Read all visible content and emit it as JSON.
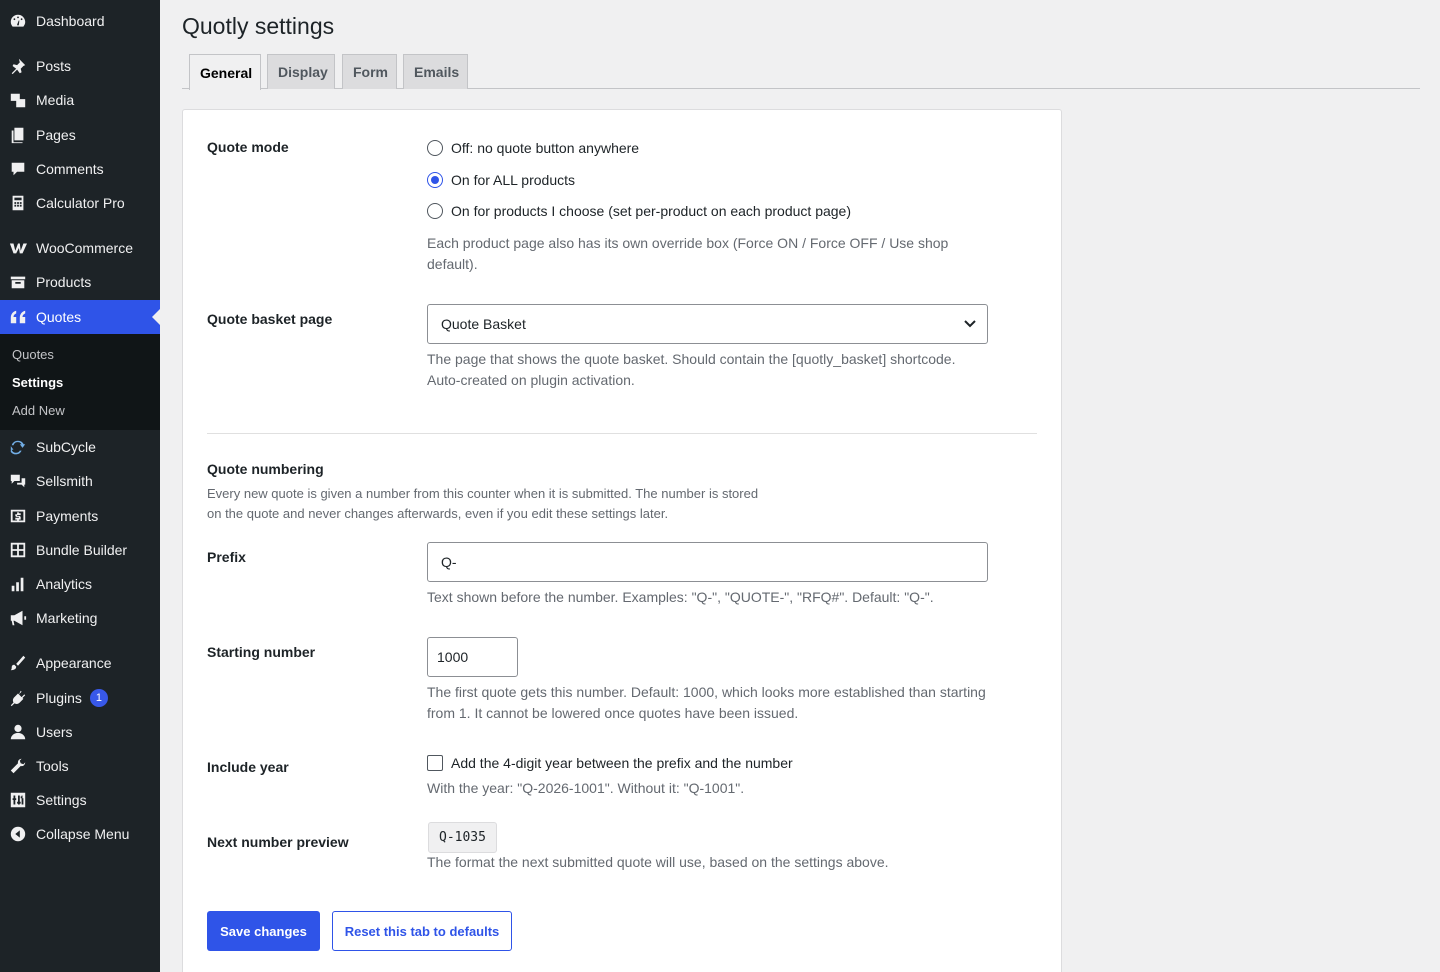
{
  "sidebar": {
    "items": [
      {
        "label": "Dashboard",
        "icon": "dashboard-icon"
      },
      {
        "label": "Posts",
        "icon": "pin-icon"
      },
      {
        "label": "Media",
        "icon": "media-icon"
      },
      {
        "label": "Pages",
        "icon": "pages-icon"
      },
      {
        "label": "Comments",
        "icon": "comment-icon"
      },
      {
        "label": "Calculator Pro",
        "icon": "calculator-icon"
      },
      {
        "label": "WooCommerce",
        "icon": "woo-icon"
      },
      {
        "label": "Products",
        "icon": "archive-icon"
      },
      {
        "label": "Quotes",
        "icon": "quote-icon"
      },
      {
        "label": "SubCycle",
        "icon": "refresh-icon"
      },
      {
        "label": "Sellsmith",
        "icon": "chat-icon"
      },
      {
        "label": "Payments",
        "icon": "dollar-icon"
      },
      {
        "label": "Bundle Builder",
        "icon": "grid-icon"
      },
      {
        "label": "Analytics",
        "icon": "bar-chart-icon"
      },
      {
        "label": "Marketing",
        "icon": "megaphone-icon"
      },
      {
        "label": "Appearance",
        "icon": "brush-icon"
      },
      {
        "label": "Plugins",
        "icon": "plug-icon",
        "badge": "1"
      },
      {
        "label": "Users",
        "icon": "user-icon"
      },
      {
        "label": "Tools",
        "icon": "wrench-icon"
      },
      {
        "label": "Settings",
        "icon": "sliders-icon"
      },
      {
        "label": "Collapse Menu",
        "icon": "collapse-icon"
      }
    ],
    "submenu": [
      "Quotes",
      "Settings",
      "Add New"
    ],
    "active": "Quotes",
    "active_color": "#2f54e8"
  },
  "page": {
    "title": "Quotly settings",
    "tabs": [
      "General",
      "Display",
      "Form",
      "Emails"
    ],
    "active_tab": "General"
  },
  "quote_mode": {
    "label": "Quote mode",
    "options": [
      "Off: no quote button anywhere",
      "On for ALL products",
      "On for products I choose (set per-product on each product page)"
    ],
    "selected": "On for ALL products",
    "description_line1": "Each product page also has its own override box (Force ON / Force OFF / Use shop",
    "description_line2": "default)."
  },
  "basket_page": {
    "label": "Quote basket page",
    "value": "Quote Basket",
    "description_line1": "The page that shows the quote basket. Should contain the [quotly_basket] shortcode.",
    "description_line2": "Auto-created on plugin activation."
  },
  "numbering": {
    "heading": "Quote numbering",
    "description_line1": "Every new quote is given a number from this counter when it is submitted. The number is stored",
    "description_line2": "on the quote and never changes afterwards, even if you edit these settings later."
  },
  "prefix": {
    "label": "Prefix",
    "value": "Q-",
    "description": "Text shown before the number. Examples: \"Q-\", \"QUOTE-\", \"RFQ#\". Default: \"Q-\"."
  },
  "starting_number": {
    "label": "Starting number",
    "value": "1000",
    "description_line1": "The first quote gets this number. Default: 1000, which looks more established than starting",
    "description_line2": "from 1. It cannot be lowered once quotes have been issued."
  },
  "include_year": {
    "label": "Include year",
    "checkbox_label": "Add the 4-digit year between the prefix and the number",
    "checked": false,
    "description": "With the year: \"Q-2026-1001\". Without it: \"Q-1001\"."
  },
  "preview": {
    "label": "Next number preview",
    "value": "Q-1035",
    "description": "The format the next submitted quote will use, based on the settings above."
  },
  "buttons": {
    "save": "Save changes",
    "reset": "Reset this tab to defaults"
  }
}
